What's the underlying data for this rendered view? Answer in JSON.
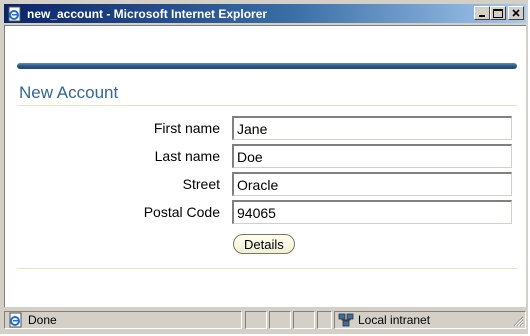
{
  "window": {
    "title": "new_account - Microsoft Internet Explorer",
    "buttons": {
      "minimize": "minimize",
      "maximize": "maximize",
      "close": "close"
    }
  },
  "page": {
    "title": "New Account",
    "fields": [
      {
        "label": "First name",
        "value": "Jane"
      },
      {
        "label": "Last name",
        "value": "Doe"
      },
      {
        "label": "Street",
        "value": "Oracle"
      },
      {
        "label": "Postal Code",
        "value": "94065"
      }
    ],
    "details_button": "Details"
  },
  "status": {
    "text": "Done",
    "zone": "Local intranet"
  },
  "icons": {
    "title": "ie-page-icon",
    "status": "ie-page-icon",
    "zone": "intranet-icon"
  },
  "colors": {
    "title_bar": "#0a246a",
    "page_title": "#336699",
    "brand_bar": "#2d5a8b"
  }
}
